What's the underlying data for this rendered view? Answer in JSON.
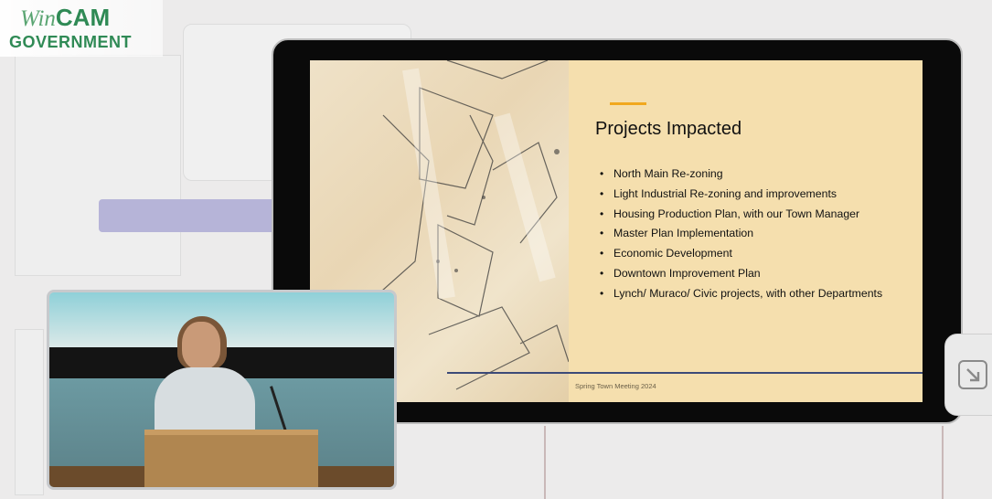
{
  "logo": {
    "script_text": "Win",
    "brand_text": "CAM",
    "bottom_text": "GOVERNMENT"
  },
  "slide": {
    "title": "Projects Impacted",
    "bullets": [
      "North Main Re-zoning",
      "Light Industrial Re-zoning and improvements",
      "Housing Production Plan, with our Town Manager",
      "Master Plan Implementation",
      "Economic Development",
      "Downtown Improvement Plan",
      "Lynch/ Muraco/ Civic projects, with other Departments"
    ],
    "footer": "Spring Town Meeting 2024"
  },
  "colors": {
    "brand_green": "#2f8a55",
    "slide_bg": "#f5dfae",
    "accent": "#f1a81e",
    "rule": "#3c4a78"
  },
  "icons": {
    "scroll_button": "arrow-down-right-icon"
  }
}
